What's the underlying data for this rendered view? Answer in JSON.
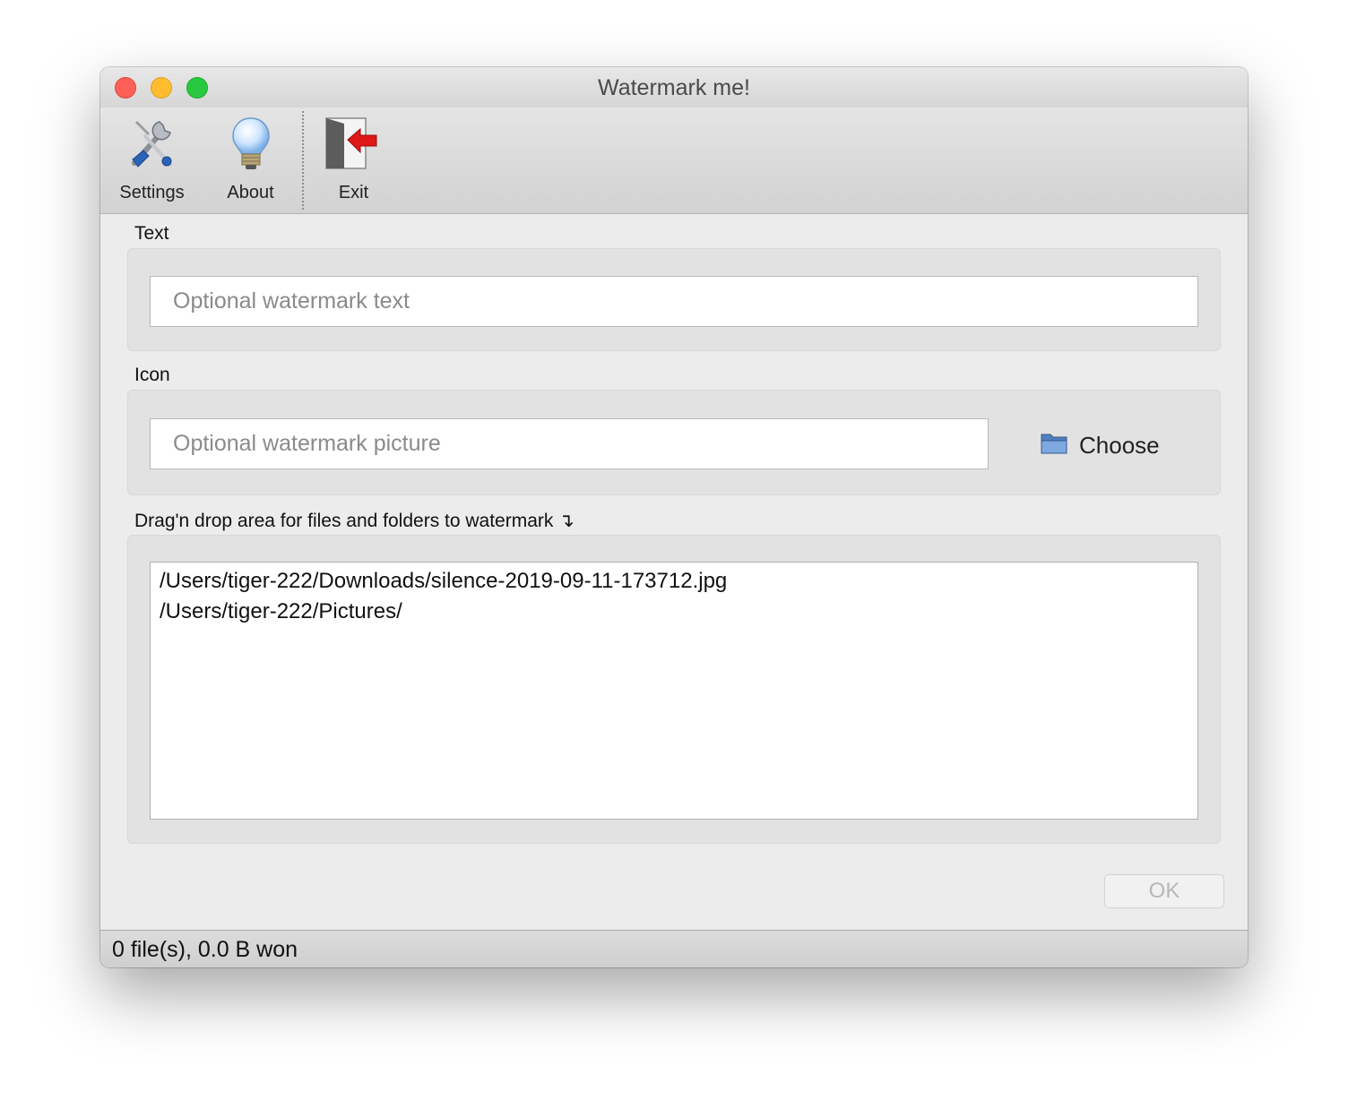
{
  "window": {
    "title": "Watermark me!"
  },
  "toolbar": {
    "items": [
      {
        "label": "Settings",
        "icon": "settings-tools-icon"
      },
      {
        "label": "About",
        "icon": "lightbulb-icon"
      },
      {
        "label": "Exit",
        "icon": "exit-door-icon"
      }
    ]
  },
  "text_section": {
    "label": "Text",
    "placeholder": "Optional watermark text",
    "value": ""
  },
  "icon_section": {
    "label": "Icon",
    "placeholder": "Optional watermark picture",
    "value": "",
    "choose_label": "Choose",
    "choose_icon": "folder-icon"
  },
  "drop_section": {
    "label": "Drag'n drop area for files and folders to watermark ↴",
    "items": [
      "/Users/tiger-222/Downloads/silence-2019-09-11-173712.jpg",
      "/Users/tiger-222/Pictures/"
    ]
  },
  "ok_button": {
    "label": "OK",
    "enabled": false
  },
  "status": {
    "text": "0 file(s), 0.0 B won"
  },
  "colors": {
    "close": "#fe5f57",
    "minimize": "#febc2e",
    "maximize": "#28c840"
  }
}
